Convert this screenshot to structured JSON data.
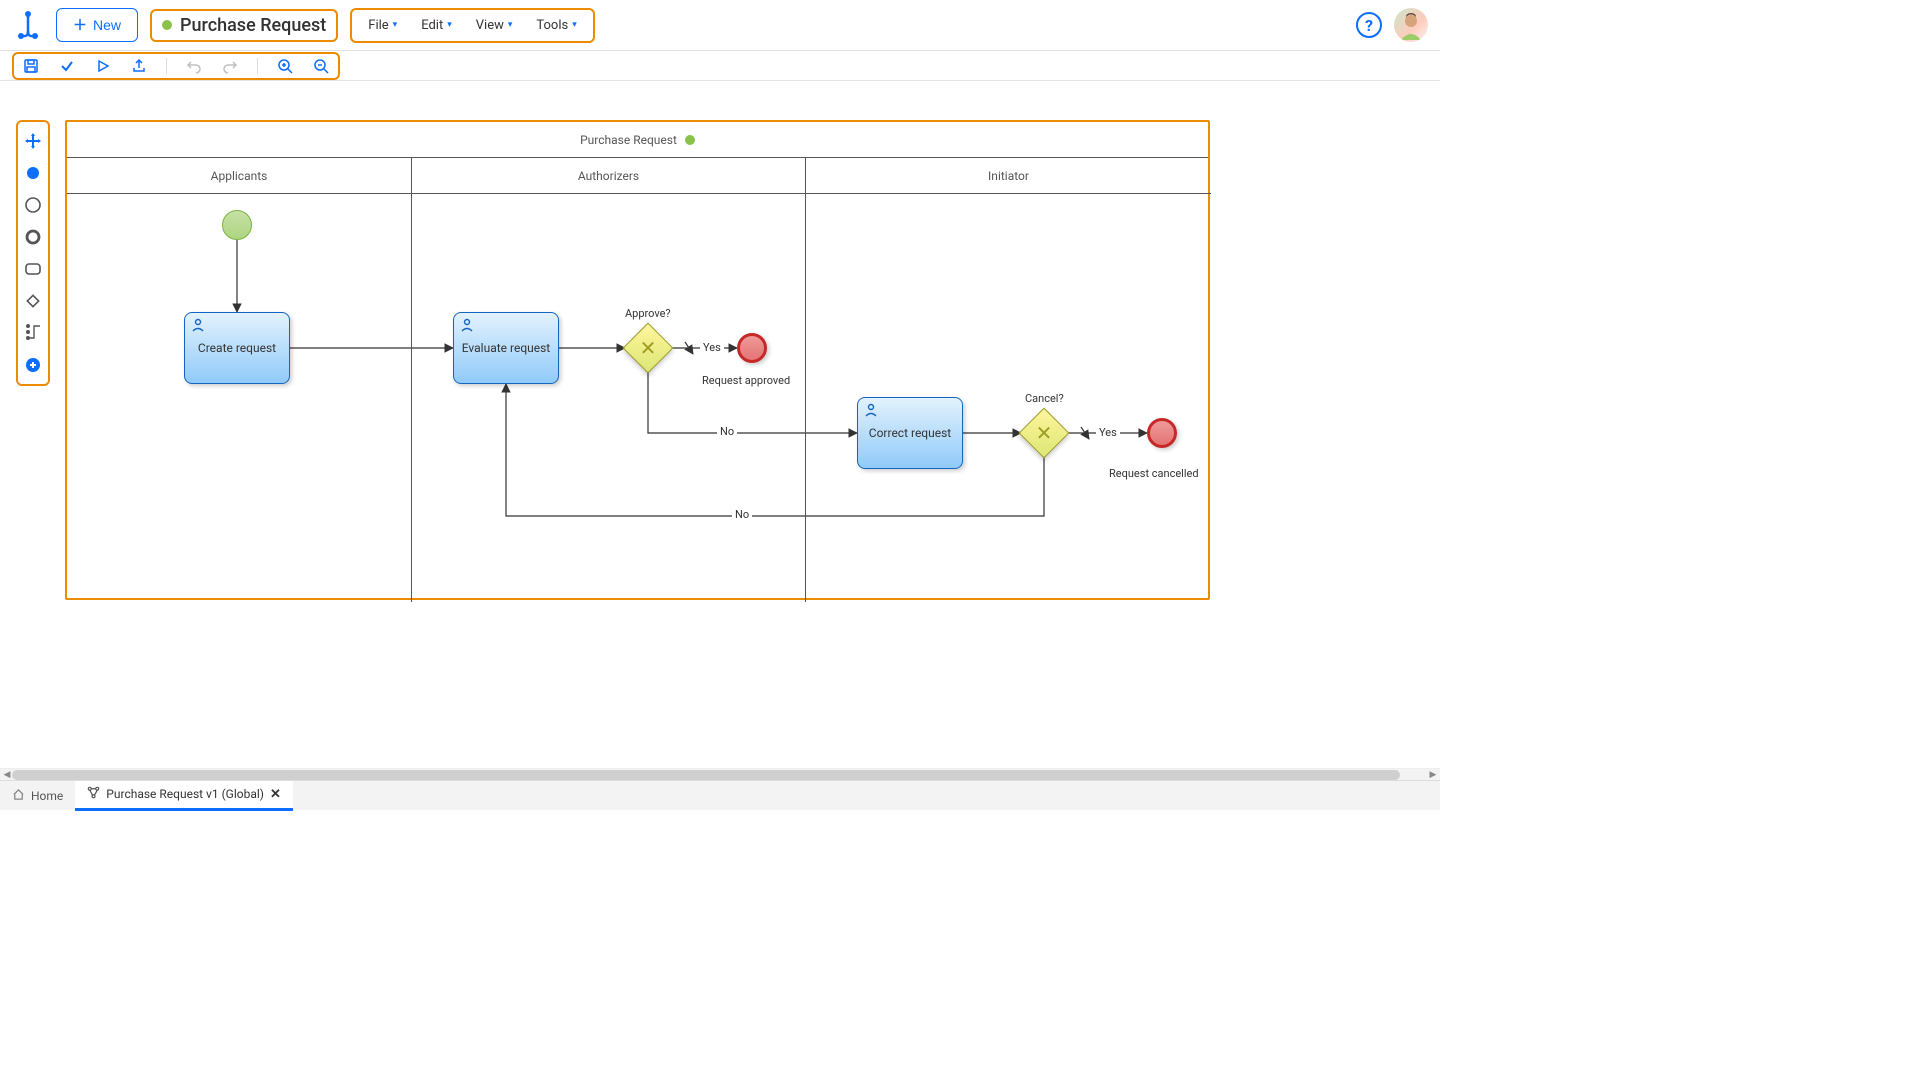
{
  "app": {
    "new_button": "New",
    "title": "Purchase Request",
    "menus": [
      "File",
      "Edit",
      "View",
      "Tools"
    ]
  },
  "toolbar": {
    "items": [
      "save",
      "validate",
      "run",
      "export",
      "sep",
      "undo",
      "redo",
      "sep",
      "zoom_in",
      "zoom_out"
    ]
  },
  "palette": {
    "items": [
      "move",
      "start",
      "intermediate",
      "end",
      "task",
      "gateway",
      "connect",
      "add"
    ]
  },
  "process": {
    "name": "Purchase Request",
    "lanes": [
      "Applicants",
      "Authorizers",
      "Initiator"
    ],
    "tasks": {
      "create": "Create request",
      "evaluate": "Evaluate request",
      "correct": "Correct request"
    },
    "gateways": {
      "approve": "Approve?",
      "cancel": "Cancel?"
    },
    "ends": {
      "approved": "Request approved",
      "cancelled": "Request cancelled"
    },
    "edges": {
      "yes": "Yes",
      "no": "No"
    }
  },
  "tabs": {
    "home": "Home",
    "current": "Purchase Request v1 (Global)"
  }
}
